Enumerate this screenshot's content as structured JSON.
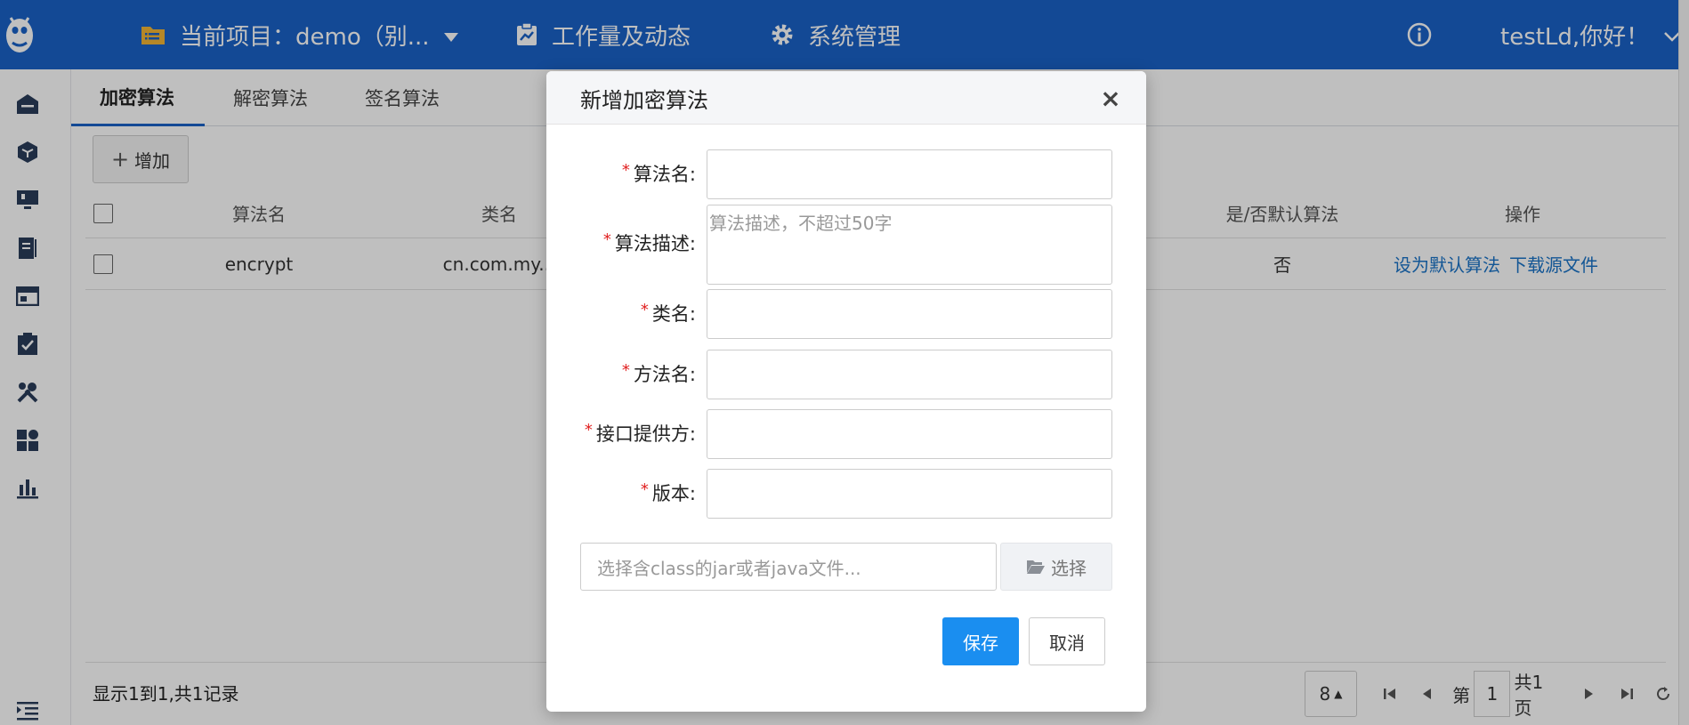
{
  "topbar": {
    "project_label": "当前项目：demo（别...",
    "workload_label": "工作量及动态",
    "system_label": "系统管理",
    "user_label": "testLd,你好！"
  },
  "sidebar": {
    "items": [
      "home-icon",
      "cube-icon",
      "monitor-icon",
      "book-icon",
      "browser-icon",
      "task-check-icon",
      "tools-icon",
      "dashboard-icon",
      "chart-icon",
      "indent-icon"
    ]
  },
  "tabs": [
    {
      "label": "加密算法",
      "active": true
    },
    {
      "label": "解密算法",
      "active": false
    },
    {
      "label": "签名算法",
      "active": false
    }
  ],
  "toolbar": {
    "add_label": "增加"
  },
  "table": {
    "headers": {
      "name": "算法名",
      "class": "类名",
      "default": "是/否默认算法",
      "actions": "操作"
    },
    "rows": [
      {
        "name": "encrypt",
        "class": "cn.com.my...",
        "default": "否",
        "action_set_default": "设为默认算法",
        "action_download": "下载源文件"
      }
    ]
  },
  "footer": {
    "record_info": "显示1到1,共1记录",
    "page_size": "8",
    "page_prefix": "第",
    "page_value": "1",
    "page_total": "共1页"
  },
  "modal": {
    "title": "新增加密算法",
    "close": "×",
    "fields": {
      "name_label": "算法名:",
      "desc_label": "算法描述:",
      "desc_placeholder": "算法描述，不超过50字",
      "class_label": "类名:",
      "method_label": "方法名:",
      "provider_label": "接口提供方:",
      "version_label": "版本:"
    },
    "required_mark": "*",
    "file_placeholder": "选择含class的jar或者java文件...",
    "file_button": "选择",
    "save": "保存",
    "cancel": "取消"
  },
  "colors": {
    "topbar": "#1a62c7",
    "primary_button": "#1a8ef0",
    "link": "#1a73c7",
    "danger": "#d00000"
  }
}
